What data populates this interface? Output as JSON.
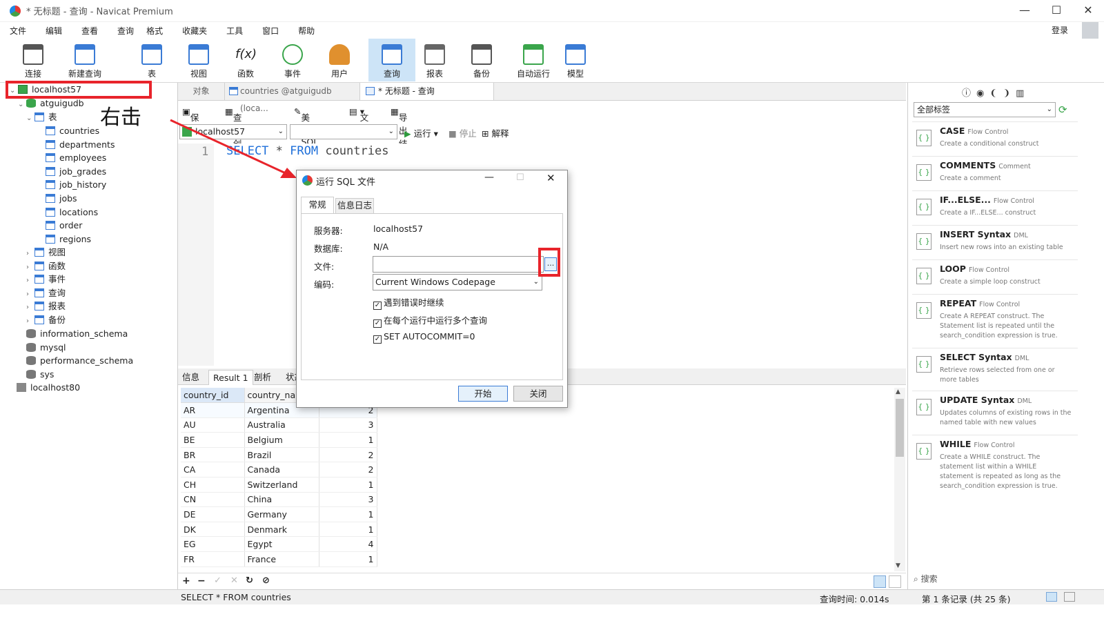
{
  "window": {
    "title": "* 无标题 - 查询 - Navicat Premium",
    "min": "—",
    "max": "☐",
    "close": "✕"
  },
  "menu": [
    "文件",
    "编辑",
    "查看",
    "查询",
    "格式",
    "收藏夹",
    "工具",
    "窗口",
    "帮助"
  ],
  "login": "登录",
  "toolbar": [
    {
      "label": "连接",
      "icon": "plug-icon",
      "color": "#555"
    },
    {
      "label": "新建查询",
      "icon": "new-query-icon",
      "color": "#3a7bd5"
    },
    {
      "label": "表",
      "icon": "table-icon",
      "color": "#3a7bd5"
    },
    {
      "label": "视图",
      "icon": "view-icon",
      "color": "#3a7bd5"
    },
    {
      "label": "函数",
      "icon": "function-icon",
      "color": "#444"
    },
    {
      "label": "事件",
      "icon": "clock-icon",
      "color": "#3aa54b"
    },
    {
      "label": "用户",
      "icon": "user-icon",
      "color": "#e0902e"
    },
    {
      "label": "查询",
      "icon": "query-icon",
      "color": "#3a7bd5"
    },
    {
      "label": "报表",
      "icon": "report-icon",
      "color": "#666"
    },
    {
      "label": "备份",
      "icon": "backup-icon",
      "color": "#555"
    },
    {
      "label": "自动运行",
      "icon": "autorun-icon",
      "color": "#3aa54b"
    },
    {
      "label": "模型",
      "icon": "model-icon",
      "color": "#3a7bd5"
    }
  ],
  "tree": {
    "server1": "localhost57",
    "db_main": "atguigudb",
    "tables_node": "表",
    "tables": [
      "countries",
      "departments",
      "employees",
      "job_grades",
      "job_history",
      "jobs",
      "locations",
      "order",
      "regions"
    ],
    "other_nodes": [
      "视图",
      "函数",
      "事件",
      "查询",
      "报表",
      "备份"
    ],
    "other_dbs": [
      "information_schema",
      "mysql",
      "performance_schema",
      "sys"
    ],
    "server2": "localhost80"
  },
  "annotation": "右击",
  "tabs": {
    "objects": "对象",
    "countries": "countries @atguigudb (loca...",
    "query": "* 无标题 - 查询"
  },
  "query_tools": {
    "save": "保存",
    "builder": "查询创建工具",
    "beautify": "美化 SQL",
    "text": "文本",
    "export": "导出结果"
  },
  "selectors": {
    "connection": "localhost57",
    "database": ""
  },
  "run_tools": {
    "run": "运行",
    "stop": "停止",
    "explain": "解释"
  },
  "editor": {
    "line": "1",
    "kw1": "SELECT",
    "mid": " * ",
    "kw2": "FROM",
    "rest": " countries"
  },
  "result_tabs": [
    "信息",
    "Result 1",
    "剖析",
    "状态"
  ],
  "grid": {
    "headers": [
      "country_id",
      "country_name",
      ""
    ],
    "rows": [
      [
        "AR",
        "Argentina",
        "2"
      ],
      [
        "AU",
        "Australia",
        "3"
      ],
      [
        "BE",
        "Belgium",
        "1"
      ],
      [
        "BR",
        "Brazil",
        "2"
      ],
      [
        "CA",
        "Canada",
        "2"
      ],
      [
        "CH",
        "Switzerland",
        "1"
      ],
      [
        "CN",
        "China",
        "3"
      ],
      [
        "DE",
        "Germany",
        "1"
      ],
      [
        "DK",
        "Denmark",
        "1"
      ],
      [
        "EG",
        "Egypt",
        "4"
      ],
      [
        "FR",
        "France",
        "1"
      ]
    ]
  },
  "grid_footer": [
    "+",
    "−",
    "✓",
    "✕",
    "↻",
    "⊘"
  ],
  "status": {
    "sql": "SELECT * FROM countries",
    "time": "查询时间: 0.014s",
    "records": "第 1 条记录 (共 25 条)"
  },
  "right_panel": {
    "filter": "全部标签",
    "search": "搜索",
    "snippets": [
      {
        "title": "CASE",
        "cat": "Flow Control",
        "desc": "Create a conditional construct"
      },
      {
        "title": "COMMENTS",
        "cat": "Comment",
        "desc": "Create a comment"
      },
      {
        "title": "IF...ELSE...",
        "cat": "Flow Control",
        "desc": "Create a IF...ELSE... construct"
      },
      {
        "title": "INSERT Syntax",
        "cat": "DML",
        "desc": "Insert new rows into an existing table"
      },
      {
        "title": "LOOP",
        "cat": "Flow Control",
        "desc": "Create a simple loop construct"
      },
      {
        "title": "REPEAT",
        "cat": "Flow Control",
        "desc": "Create A REPEAT construct. The Statement list is repeated until the search_condition expression is true."
      },
      {
        "title": "SELECT Syntax",
        "cat": "DML",
        "desc": "Retrieve rows selected from one or more tables"
      },
      {
        "title": "UPDATE Syntax",
        "cat": "DML",
        "desc": "Updates columns of existing rows in the named table with new values"
      },
      {
        "title": "WHILE",
        "cat": "Flow Control",
        "desc": "Create a WHILE construct. The statement list within a WHILE statement is repeated as long as the search_condition expression is true."
      }
    ]
  },
  "dialog": {
    "title": "运行 SQL 文件",
    "tab_general": "常规",
    "tab_log": "信息日志",
    "server_label": "服务器:",
    "server_value": "localhost57",
    "db_label": "数据库:",
    "db_value": "N/A",
    "file_label": "文件:",
    "file_value": "",
    "browse": "...",
    "enc_label": "编码:",
    "enc_value": "Current Windows Codepage",
    "opt1": "遇到错误时继续",
    "opt2": "在每个运行中运行多个查询",
    "opt3": "SET AUTOCOMMIT=0",
    "start": "开始",
    "close": "关闭"
  },
  "colors": {
    "highlight_red": "#e8242b",
    "accent_blue": "#1e6fd9",
    "selected_tab_bg": "#cde4f7"
  }
}
